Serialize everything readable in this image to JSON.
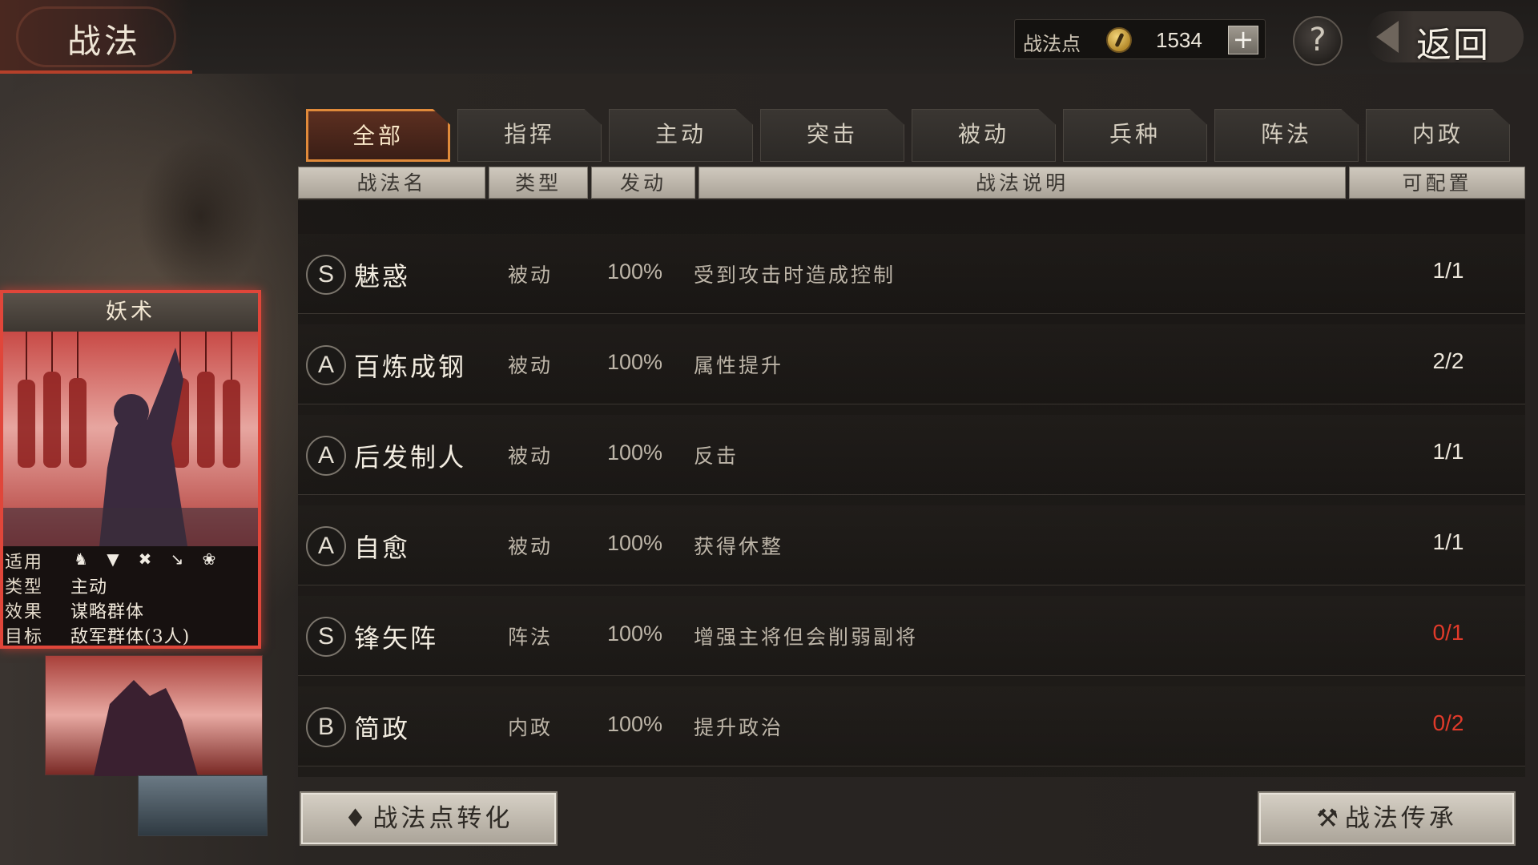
{
  "header": {
    "title": "战法",
    "points_label": "战法点",
    "points_value": "1534",
    "plus_label": "+",
    "help_label": "?",
    "back_label": "返回"
  },
  "tabs": [
    {
      "label": "全部",
      "active": true
    },
    {
      "label": "指挥",
      "active": false
    },
    {
      "label": "主动",
      "active": false
    },
    {
      "label": "突击",
      "active": false
    },
    {
      "label": "被动",
      "active": false
    },
    {
      "label": "兵种",
      "active": false
    },
    {
      "label": "阵法",
      "active": false
    },
    {
      "label": "内政",
      "active": false
    }
  ],
  "columns": [
    "战法名",
    "类型",
    "发动",
    "战法说明",
    "可配置"
  ],
  "skills": [
    {
      "grade": "S",
      "name": "魅惑",
      "type": "被动",
      "rate": "100%",
      "desc": "受到攻击时造成控制",
      "count": "1/1",
      "available": true
    },
    {
      "grade": "A",
      "name": "百炼成钢",
      "type": "被动",
      "rate": "100%",
      "desc": "属性提升",
      "count": "2/2",
      "available": true
    },
    {
      "grade": "A",
      "name": "后发制人",
      "type": "被动",
      "rate": "100%",
      "desc": "反击",
      "count": "1/1",
      "available": true
    },
    {
      "grade": "A",
      "name": "自愈",
      "type": "被动",
      "rate": "100%",
      "desc": "获得休整",
      "count": "1/1",
      "available": true
    },
    {
      "grade": "S",
      "name": "锋矢阵",
      "type": "阵法",
      "rate": "100%",
      "desc": "增强主将但会削弱副将",
      "count": "0/1",
      "available": false
    },
    {
      "grade": "B",
      "name": "简政",
      "type": "内政",
      "rate": "100%",
      "desc": "提升政治",
      "count": "0/2",
      "available": false
    }
  ],
  "buttons": {
    "convert_label": "战法点转化",
    "inherit_label": "战法传承"
  },
  "card": {
    "title": "妖术",
    "applicable_label": "适用",
    "unit_icons": [
      "cavalry-icon",
      "shield-icon",
      "bow-icon",
      "spear-icon",
      "siege-icon"
    ],
    "type_label": "类型",
    "type_value": "主动",
    "effect_label": "效果",
    "effect_value": "谋略群体",
    "target_label": "目标",
    "target_value": "敌军群体(3人)"
  },
  "colors": {
    "accent_active": "#e08a3a",
    "count_unavailable": "#e03a2a",
    "card_border": "#e0463a"
  }
}
